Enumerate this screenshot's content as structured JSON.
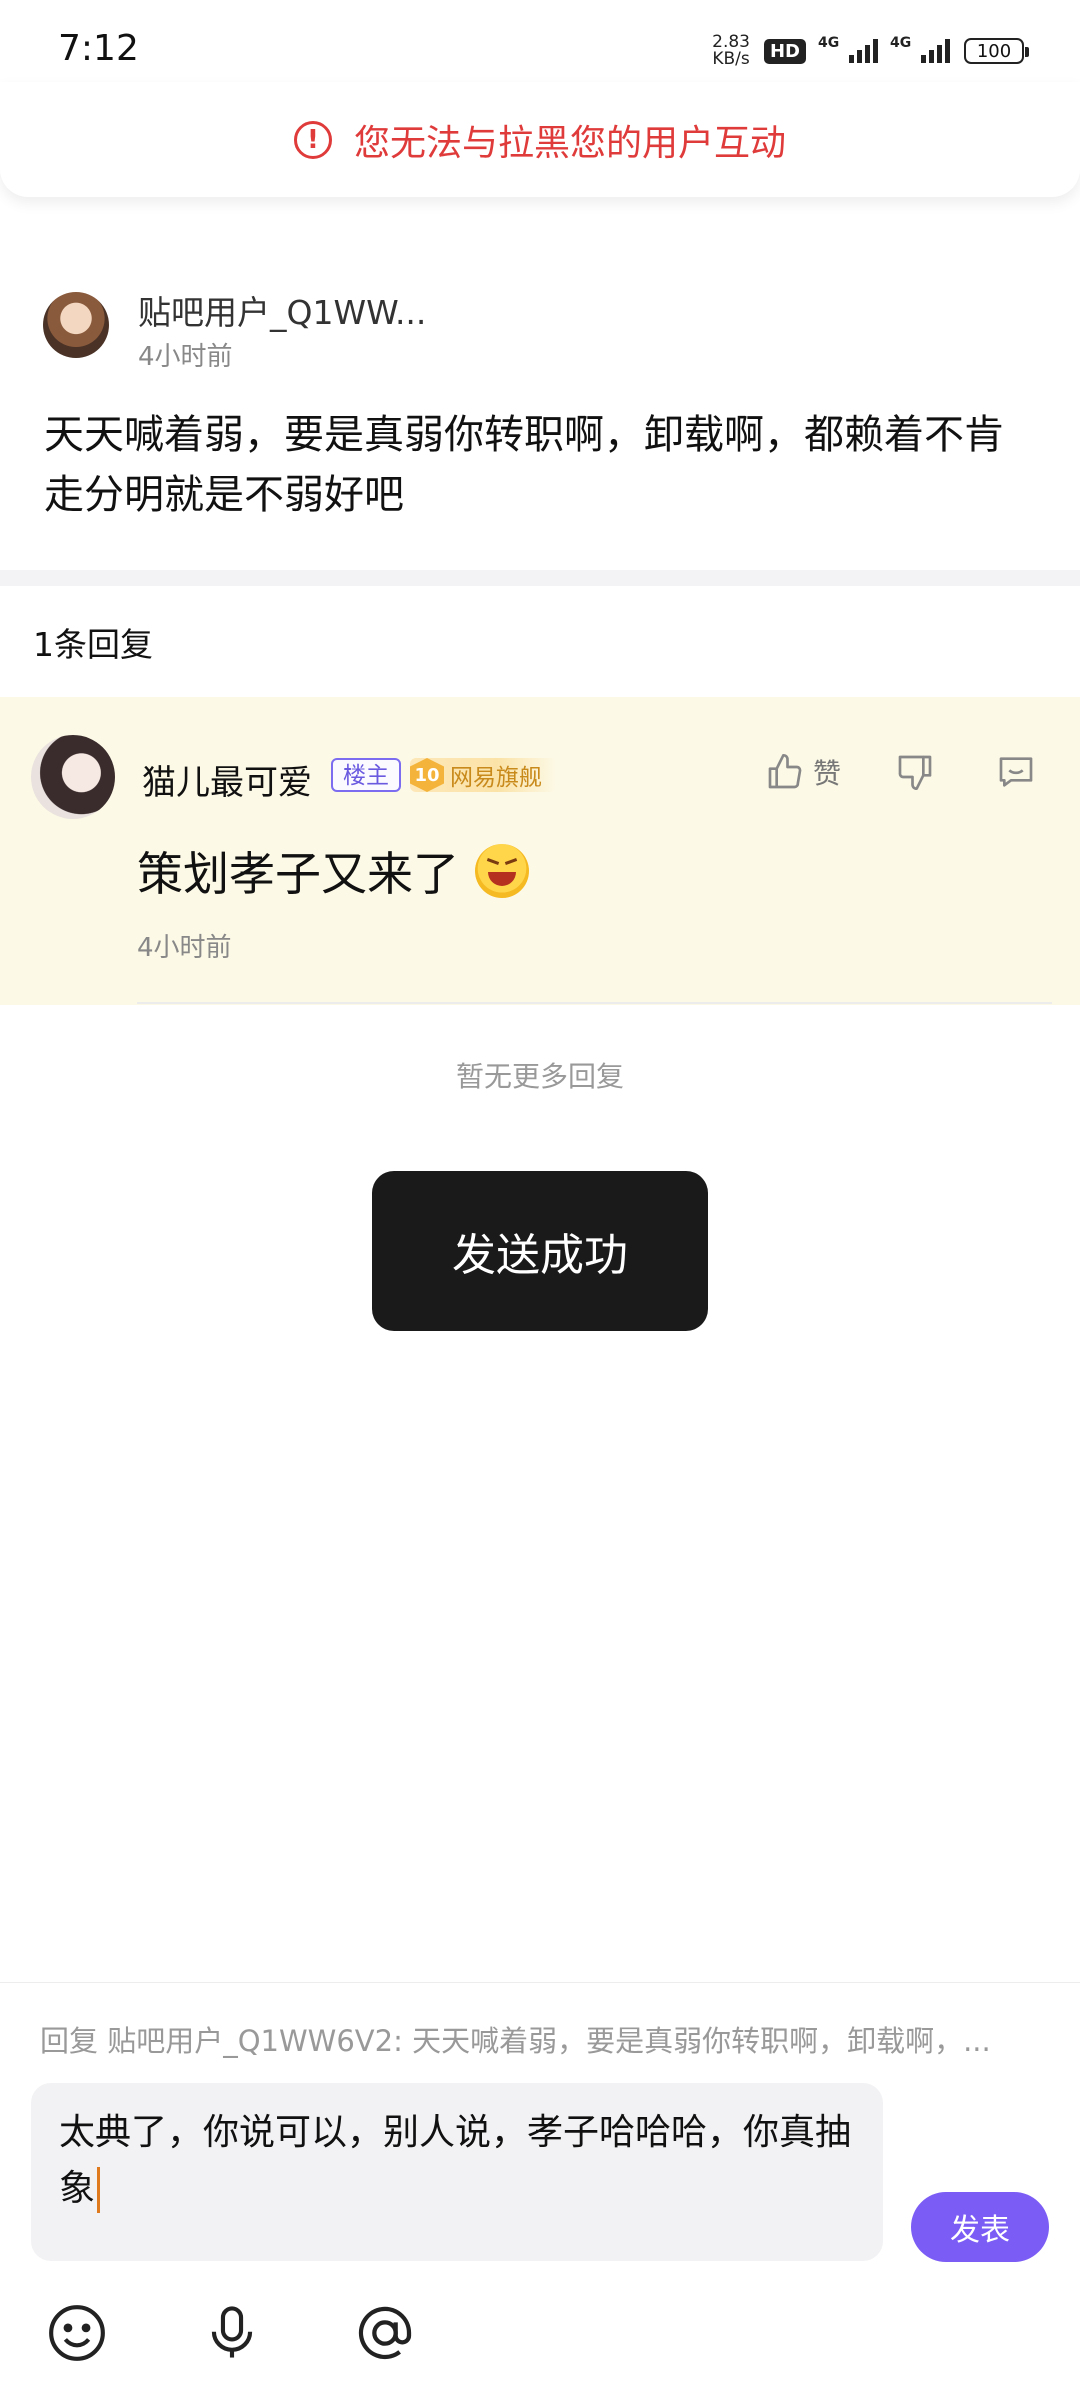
{
  "status_bar": {
    "time": "7:12",
    "net_speed_value": "2.83",
    "net_speed_unit": "KB/s",
    "hd_label": "HD",
    "sig1_label": "4G",
    "sig2_label": "4G",
    "battery": "100"
  },
  "warning": {
    "text": "您无法与拉黑您的用户互动"
  },
  "post": {
    "author": "贴吧用户_Q1WW...",
    "time": "4小时前",
    "body": "天天喊着弱，要是真弱你转职啊，卸载啊，都赖着不肯走分明就是不弱好吧"
  },
  "replies_header": "1条回复",
  "reply": {
    "author": "猫儿最可爱",
    "op_badge": "楼主",
    "level": "10",
    "level_label": "网易旗舰",
    "like_label": "赞",
    "text": "策划孝子又来了",
    "time": "4小时前"
  },
  "no_more": "暂无更多回复",
  "toast": "发送成功",
  "composer": {
    "reply_ref": "回复 贴吧用户_Q1WW6V2: 天天喊着弱，要是真弱你转职啊，卸载啊，...",
    "input_text": "太典了，你说可以，别人说，孝子哈哈哈，你真抽象",
    "publish_label": "发表"
  },
  "icons": {
    "like": "thumb-up-icon",
    "dislike": "thumb-down-icon",
    "comment": "comment-icon",
    "emoji": "smile-icon",
    "voice": "microphone-icon",
    "mention": "at-icon"
  },
  "colors": {
    "warning": "#e03b3b",
    "accent": "#7b5cf5",
    "reply_bg": "#fcf9e6"
  }
}
